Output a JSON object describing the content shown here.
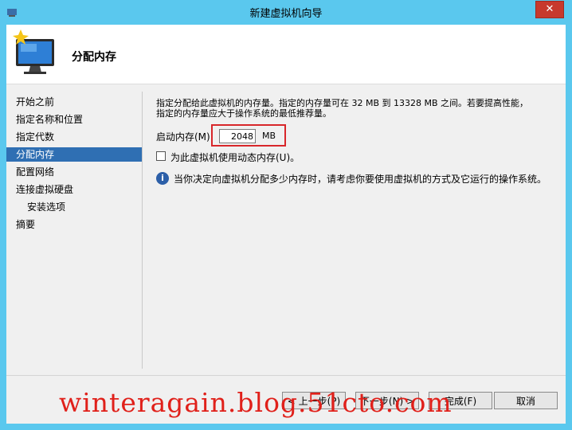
{
  "window": {
    "title": "新建虚拟机向导",
    "close_glyph": "✕"
  },
  "header": {
    "title": "分配内存"
  },
  "sidebar": {
    "items": [
      {
        "label": "开始之前"
      },
      {
        "label": "指定名称和位置"
      },
      {
        "label": "指定代数"
      },
      {
        "label": "分配内存"
      },
      {
        "label": "配置网络"
      },
      {
        "label": "连接虚拟硬盘"
      },
      {
        "label": "安装选项"
      },
      {
        "label": "摘要"
      }
    ],
    "selected_index": 3
  },
  "content": {
    "description_line1": "指定分配给此虚拟机的内存量。指定的内存量可在 32 MB 到 13328 MB 之间。若要提高性能，",
    "description_line2": "指定的内存量应大于操作系统的最低推荐量。",
    "startup_memory_label": "启动内存(M):",
    "startup_memory_value": "2048",
    "startup_memory_unit": "MB",
    "dynamic_memory_label": "为此虚拟机使用动态内存(U)。",
    "dynamic_memory_checked": false,
    "info_text": "当你决定向虚拟机分配多少内存时，请考虑你要使用虚拟机的方式及它运行的操作系统。"
  },
  "buttons": {
    "previous": "< 上一步(P)",
    "next": "下一步(N) >",
    "finish": "完成(F)",
    "cancel": "取消"
  },
  "watermark": {
    "text": "winteragain.blog.51cto.com"
  },
  "colors": {
    "titlebar": "#5ac8ee",
    "selected_nav": "#2f6fb3",
    "highlight_box": "#d8262a",
    "watermark": "#e0201a",
    "close_button": "#c7392d"
  }
}
